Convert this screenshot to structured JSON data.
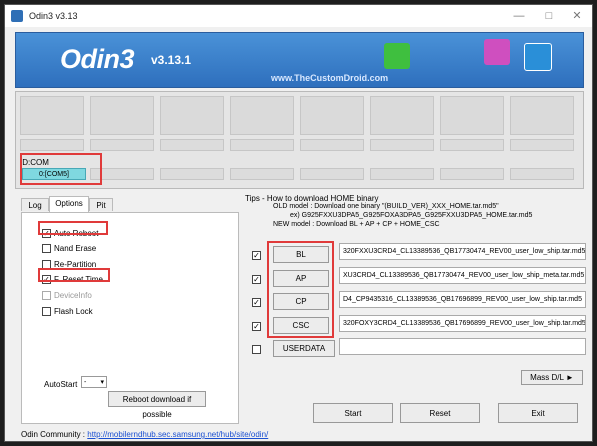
{
  "window": {
    "title": "Odin3 v3.13"
  },
  "banner": {
    "logo": "Odin3",
    "version": "v3.13.1",
    "watermark": "www.TheCustomDroid.com"
  },
  "idcom": {
    "label": "ID:COM",
    "port": "0:[COM5]"
  },
  "tabs": [
    {
      "label": "Log"
    },
    {
      "label": "Options"
    },
    {
      "label": "Pit"
    }
  ],
  "options": {
    "items": [
      {
        "label": "Auto Reboot",
        "checked": true,
        "enabled": true
      },
      {
        "label": "Nand Erase",
        "checked": false,
        "enabled": true
      },
      {
        "label": "Re-Partition",
        "checked": false,
        "enabled": true
      },
      {
        "label": "F. Reset Time",
        "checked": true,
        "enabled": true
      },
      {
        "label": "DeviceInfo",
        "checked": false,
        "enabled": false
      },
      {
        "label": "Flash Lock",
        "checked": false,
        "enabled": true
      }
    ],
    "autostart_label": "AutoStart",
    "autostart_value": "-",
    "reboot_button": "Reboot download if possible"
  },
  "tips": {
    "title": "Tips - How to download HOME binary",
    "line1": "OLD model  : Download one binary    \"(BUILD_VER)_XXX_HOME.tar.md5\"",
    "line2": "ex) G925FXXU3DPA5_G925FOXA3DPA5_G925FXXU3DPA5_HOME.tar.md5",
    "line3": "NEW model : Download BL + AP + CP + HOME_CSC"
  },
  "files": [
    {
      "label": "BL",
      "checked": true,
      "path": "320FXXU3CRD4_CL13389536_QB17730474_REV00_user_low_ship.tar.md5"
    },
    {
      "label": "AP",
      "checked": true,
      "path": "XU3CRD4_CL13389536_QB17730474_REV00_user_low_ship_meta.tar.md5"
    },
    {
      "label": "CP",
      "checked": true,
      "path": "D4_CP9435316_CL13389536_QB17696899_REV00_user_low_ship.tar.md5"
    },
    {
      "label": "CSC",
      "checked": true,
      "path": "320FOXY3CRD4_CL13389536_QB17696899_REV00_user_low_ship.tar.md5"
    },
    {
      "label": "USERDATA",
      "checked": false,
      "path": ""
    }
  ],
  "buttons": {
    "massdl": "Mass D/L ►",
    "start": "Start",
    "reset": "Reset",
    "exit": "Exit"
  },
  "community": {
    "label": "Odin Community : ",
    "link": "http://mobilerndhub.sec.samsung.net/hub/site/odin/"
  },
  "colors": {
    "banner": "#2e6fbd",
    "com_active": "#7fd8e0",
    "highlight": "#e03a3a"
  }
}
